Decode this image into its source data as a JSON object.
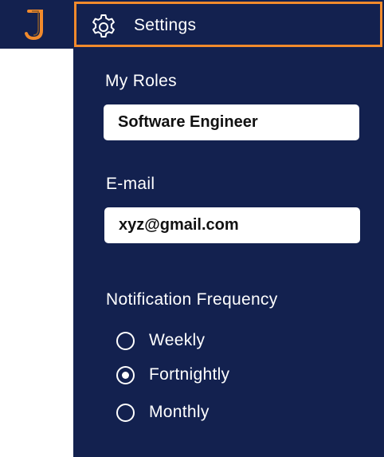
{
  "header": {
    "logo_icon": "j-logo-icon",
    "settings_icon": "gear-icon",
    "title": "Settings",
    "accent_color": "#f18a2c",
    "background_color": "#13214f"
  },
  "roles": {
    "label": "My Roles",
    "value": "Software Engineer"
  },
  "email": {
    "label": "E-mail",
    "value": "xyz@gmail.com"
  },
  "notification": {
    "label": "Notification Frequency",
    "options": [
      {
        "label": "Weekly",
        "checked": false
      },
      {
        "label": "Fortnightly",
        "checked": true
      },
      {
        "label": "Monthly",
        "checked": false
      }
    ]
  }
}
